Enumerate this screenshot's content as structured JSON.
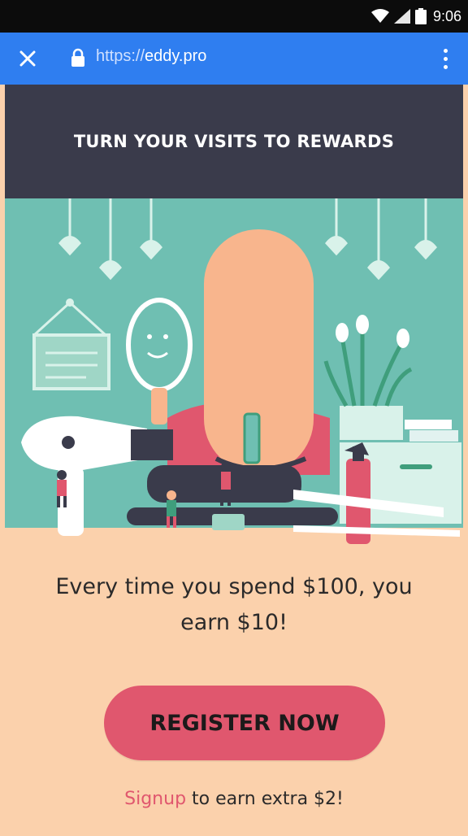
{
  "status_bar": {
    "time": "9:06",
    "icons": [
      "wifi-icon",
      "signal-icon",
      "battery-icon"
    ]
  },
  "browser": {
    "url_scheme": "https://",
    "url_host": "eddy.pro",
    "icons": [
      "close-icon",
      "lock-icon",
      "overflow-menu-icon"
    ]
  },
  "banner": {
    "title": "TURN YOUR VISITS TO REWARDS"
  },
  "promo": {
    "line1": "Every time you spend $100, you",
    "line2": "earn $10!"
  },
  "cta": {
    "register_label": "REGISTER NOW"
  },
  "signup": {
    "link_label": "Signup",
    "rest_label": " to earn extra $2!"
  },
  "colors": {
    "status_bar": "#0c0c0c",
    "browser_bar": "#2f7ef0",
    "banner": "#3a3b4b",
    "hero_bg": "#6fbfb2",
    "page_bg": "#fbd1ac",
    "accent": "#e0576e"
  }
}
